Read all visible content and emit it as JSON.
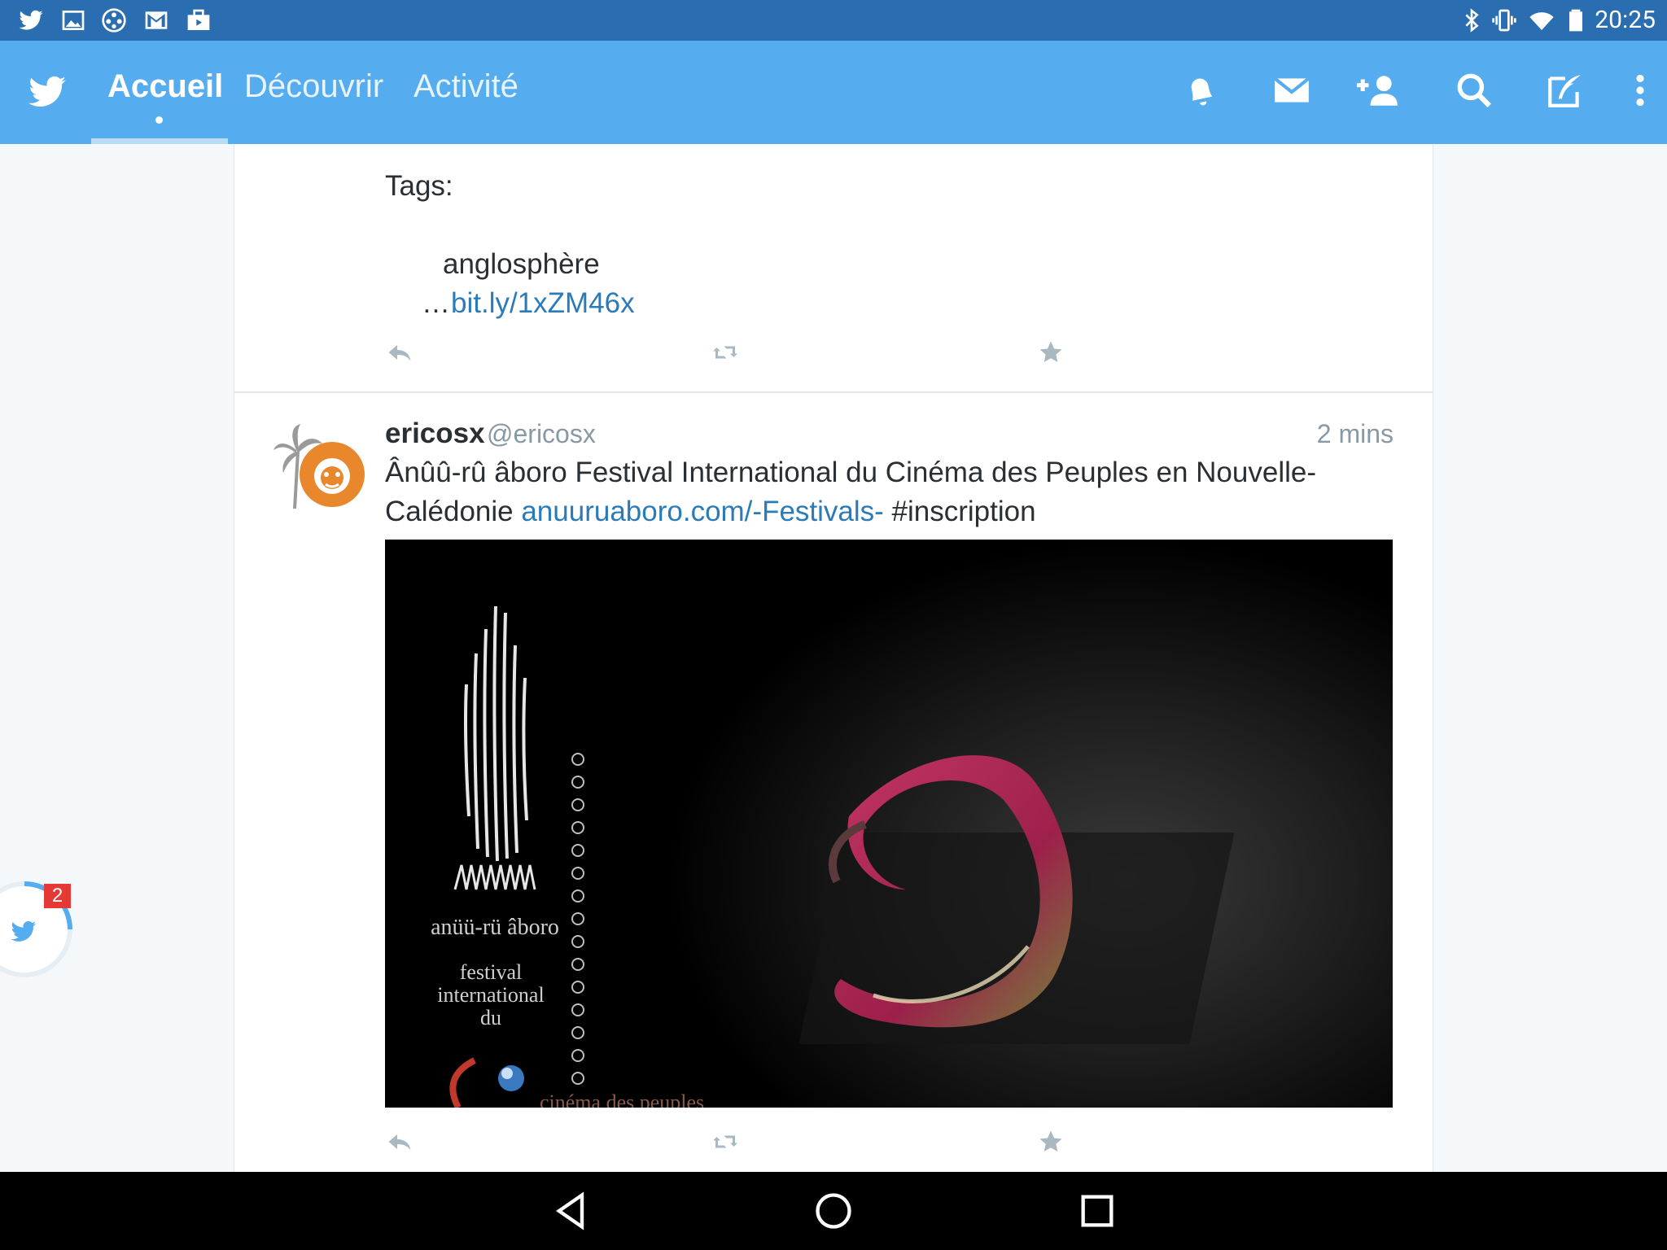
{
  "status_bar": {
    "time": "20:25",
    "left_icons": [
      "twitter-icon",
      "image-icon",
      "film-reel-icon",
      "gmail-icon",
      "briefcase-icon"
    ],
    "right_icons": [
      "bluetooth-icon",
      "vibrate-icon",
      "wifi-icon",
      "battery-icon"
    ]
  },
  "app_bar": {
    "tabs": [
      {
        "label": "Accueil",
        "active": true
      },
      {
        "label": "Découvrir",
        "active": false
      },
      {
        "label": "Activité",
        "active": false
      }
    ],
    "actions": [
      "notifications-icon",
      "messages-icon",
      "add-user-icon",
      "search-icon",
      "compose-tweet-icon",
      "overflow-menu-icon"
    ]
  },
  "tweets": [
    {
      "text_lines": [
        "Tags:",
        "anglosphère"
      ],
      "ellipsis": "…",
      "link": "bit.ly/1xZM46x",
      "actions": [
        "reply-icon",
        "retweet-icon",
        "favorite-icon"
      ]
    },
    {
      "author_name": "ericosx",
      "author_handle": "@ericosx",
      "timestamp": "2 mins",
      "text_line1": "Ânûû-rû âboro  Festival International du Cinéma des Peuples en Nouvelle-",
      "text_line2_start": "Calédonie ",
      "link": "anuuruaboro.com/-Festivals-",
      "hashtag": " #inscription",
      "media": {
        "title": "anüü-rü âboro",
        "subtitle_lines": [
          "festival",
          "international",
          "du"
        ],
        "footer": "cinéma des peuples"
      },
      "actions": [
        "reply-icon",
        "retweet-icon",
        "favorite-icon"
      ]
    }
  ],
  "chat_head": {
    "badge": "2"
  },
  "nav_bar": [
    "back-icon",
    "home-icon",
    "recents-icon"
  ]
}
